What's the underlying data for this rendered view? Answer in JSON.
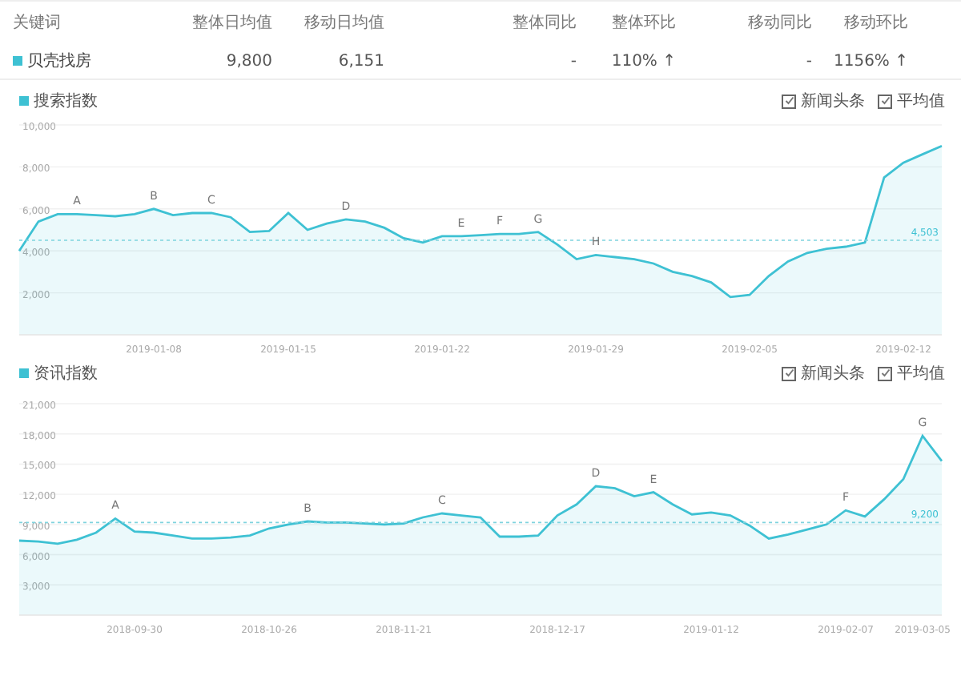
{
  "table": {
    "columns": [
      "关键词",
      "整体日均值",
      "移动日均值",
      "整体同比",
      "整体环比",
      "移动同比",
      "移动环比"
    ],
    "rows": [
      {
        "color": "#3ec1d3",
        "cells": [
          "贝壳找房",
          "9,800",
          "6,151",
          "-",
          "110% ↑",
          "-",
          "1156% ↑"
        ]
      }
    ]
  },
  "charts": [
    {
      "toggles": [
        {
          "label": "新闻头条",
          "checked": true
        },
        {
          "label": "平均值",
          "checked": true
        }
      ],
      "chart_data": {
        "type": "area",
        "grid": true,
        "ylim": [
          0,
          10000
        ],
        "yticks": [
          {
            "value": 2000,
            "label": "2,000"
          },
          {
            "value": 4000,
            "label": "4,000"
          },
          {
            "value": 6000,
            "label": "6,000"
          },
          {
            "value": 8000,
            "label": "8,000"
          },
          {
            "value": 10000,
            "label": "10,000"
          }
        ],
        "categories": [
          null,
          null,
          null,
          null,
          null,
          null,
          null,
          "2019-01-08",
          null,
          null,
          null,
          null,
          null,
          null,
          "2019-01-15",
          null,
          null,
          null,
          null,
          null,
          null,
          null,
          "2019-01-22",
          null,
          null,
          null,
          null,
          null,
          null,
          null,
          "2019-01-29",
          null,
          null,
          null,
          null,
          null,
          null,
          null,
          "2019-02-05",
          null,
          null,
          null,
          null,
          null,
          null,
          null,
          "2019-02-12",
          null,
          null
        ],
        "series": [
          {
            "name": "搜索指数",
            "color": "#3ec1d3",
            "values": [
              4000,
              5400,
              5750,
              5750,
              5700,
              5650,
              5750,
              6000,
              5700,
              5800,
              5800,
              5600,
              4900,
              4950,
              5800,
              5000,
              5300,
              5500,
              5400,
              5100,
              4600,
              4400,
              4700,
              4700,
              4750,
              4800,
              4800,
              4900,
              4300,
              3600,
              3800,
              3700,
              3600,
              3400,
              3000,
              2800,
              2500,
              1800,
              1900,
              2800,
              3500,
              3900,
              4100,
              4200,
              4400,
              7500,
              8200,
              8600,
              9000
            ]
          }
        ],
        "ref_lines": [
          {
            "axis": "y",
            "value": 4503,
            "label": "4,503"
          }
        ],
        "value_labels": [
          null,
          null,
          null,
          "A",
          null,
          null,
          null,
          "B",
          null,
          null,
          "C",
          null,
          null,
          null,
          null,
          null,
          null,
          "D",
          null,
          null,
          null,
          null,
          null,
          "E",
          null,
          "F",
          null,
          "G",
          null,
          null,
          "H",
          null,
          null,
          null,
          null,
          null,
          null,
          null,
          null,
          null,
          null,
          null,
          null,
          null,
          null,
          null,
          null,
          null,
          null
        ]
      }
    },
    {
      "toggles": [
        {
          "label": "新闻头条",
          "checked": true
        },
        {
          "label": "平均值",
          "checked": true
        }
      ],
      "chart_data": {
        "type": "area",
        "grid": true,
        "ylim": [
          0,
          21000
        ],
        "yticks": [
          {
            "value": 3000,
            "label": "3,000"
          },
          {
            "value": 6000,
            "label": "6,000"
          },
          {
            "value": 9000,
            "label": "9,000"
          },
          {
            "value": 12000,
            "label": "12,000"
          },
          {
            "value": 15000,
            "label": "15,000"
          },
          {
            "value": 18000,
            "label": "18,000"
          },
          {
            "value": 21000,
            "label": "21,000"
          }
        ],
        "categories": [
          null,
          null,
          null,
          null,
          null,
          null,
          "2018-09-30",
          null,
          null,
          null,
          null,
          null,
          null,
          "2018-10-26",
          null,
          null,
          null,
          null,
          null,
          null,
          "2018-11-21",
          null,
          null,
          null,
          null,
          null,
          null,
          null,
          "2018-12-17",
          null,
          null,
          null,
          null,
          null,
          null,
          null,
          "2019-01-12",
          null,
          null,
          null,
          null,
          null,
          null,
          "2019-02-07",
          null,
          null,
          null,
          "2019-03-05",
          null
        ],
        "series": [
          {
            "name": "资讯指数",
            "color": "#3ec1d3",
            "values": [
              7400,
              7300,
              7100,
              7500,
              8200,
              9600,
              8300,
              8200,
              7900,
              7600,
              7600,
              7700,
              7900,
              8600,
              9000,
              9300,
              9200,
              9200,
              9100,
              9000,
              9100,
              9700,
              10100,
              9900,
              9700,
              7800,
              7800,
              7900,
              9900,
              11000,
              12800,
              12600,
              11800,
              12200,
              11000,
              10000,
              10200,
              9900,
              8900,
              7600,
              8000,
              8500,
              9000,
              10400,
              9800,
              11500,
              13500,
              17800,
              15300
            ]
          }
        ],
        "ref_lines": [
          {
            "axis": "y",
            "value": 9200,
            "label": "9,200"
          }
        ],
        "value_labels": [
          null,
          null,
          null,
          null,
          null,
          "A",
          null,
          null,
          null,
          null,
          null,
          null,
          null,
          null,
          null,
          "B",
          null,
          null,
          null,
          null,
          null,
          null,
          "C",
          null,
          null,
          null,
          null,
          null,
          null,
          null,
          "D",
          null,
          null,
          "E",
          null,
          null,
          null,
          null,
          null,
          null,
          null,
          null,
          null,
          "F",
          null,
          null,
          null,
          "G",
          null
        ]
      }
    }
  ]
}
